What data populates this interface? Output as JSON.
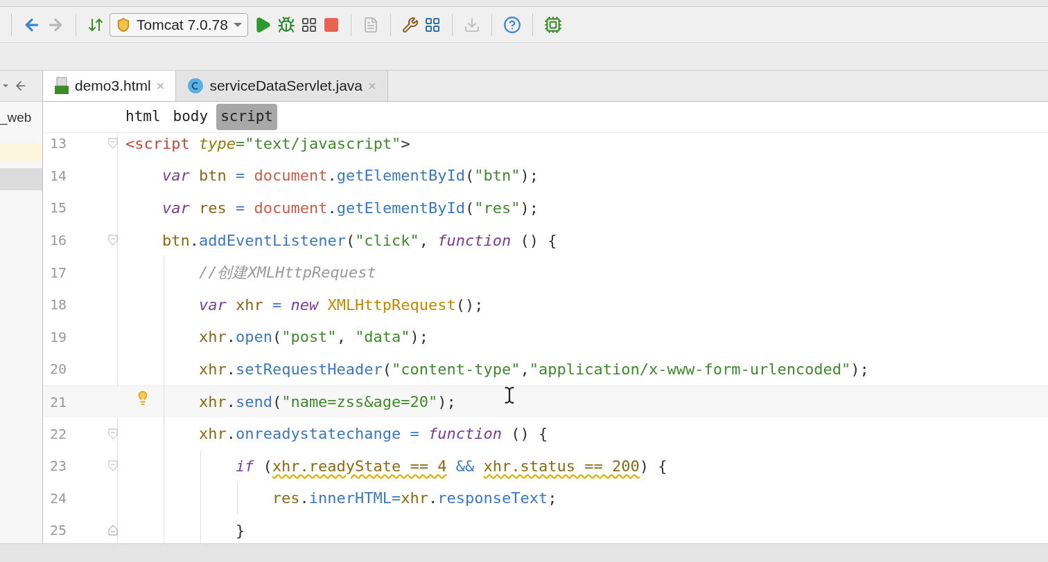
{
  "toolbar": {
    "run_config": "Tomcat 7.0.78"
  },
  "project_panel": {
    "label": "_web"
  },
  "tabs": [
    {
      "label": "demo3.html",
      "kind": "html",
      "selected": true,
      "close": "×"
    },
    {
      "label": "serviceDataServlet.java",
      "kind": "java",
      "selected": false,
      "close": "×"
    }
  ],
  "breadcrumbs": [
    {
      "label": "html",
      "selected": false
    },
    {
      "label": "body",
      "selected": false
    },
    {
      "label": "script",
      "selected": true
    }
  ],
  "code_lines": [
    {
      "number": "13",
      "tokens": [
        {
          "text": "<script",
          "kind": "tag"
        },
        {
          "text": " type",
          "kind": "attr"
        },
        {
          "text": "=\"text/javascript\"",
          "kind": "string"
        },
        {
          "text": ">",
          "kind": "plain"
        }
      ],
      "children": [
        {
          "number": "14",
          "tokens": [
            {
              "text": "var",
              "kind": "keyword"
            },
            {
              "text": " btn",
              "kind": "ident"
            },
            {
              "text": " = ",
              "kind": "op"
            },
            {
              "text": "document",
              "kind": "global"
            },
            {
              "text": ".",
              "kind": "plain"
            },
            {
              "text": "getElementById",
              "kind": "method"
            },
            {
              "text": "(",
              "kind": "plain"
            },
            {
              "text": "\"btn\"",
              "kind": "string"
            },
            {
              "text": ");",
              "kind": "plain"
            }
          ]
        },
        {
          "number": "15",
          "tokens": [
            {
              "text": "var",
              "kind": "keyword"
            },
            {
              "text": " res",
              "kind": "ident"
            },
            {
              "text": " = ",
              "kind": "op"
            },
            {
              "text": "document",
              "kind": "global"
            },
            {
              "text": ".",
              "kind": "plain"
            },
            {
              "text": "getElementById",
              "kind": "method"
            },
            {
              "text": "(",
              "kind": "plain"
            },
            {
              "text": "\"res\"",
              "kind": "string"
            },
            {
              "text": ");",
              "kind": "plain"
            }
          ]
        },
        {
          "number": "16",
          "tokens": [
            {
              "text": "btn",
              "kind": "ident"
            },
            {
              "text": ".",
              "kind": "plain"
            },
            {
              "text": "addEventListener",
              "kind": "method"
            },
            {
              "text": "(",
              "kind": "plain"
            },
            {
              "text": "\"click\"",
              "kind": "string"
            },
            {
              "text": ", ",
              "kind": "plain"
            },
            {
              "text": "function",
              "kind": "keyword"
            },
            {
              "text": " () {",
              "kind": "plain"
            }
          ],
          "children": [
            {
              "number": "17",
              "tokens": [
                {
                  "text": "//创建XMLHttpRequest",
                  "kind": "comment"
                }
              ]
            },
            {
              "number": "18",
              "tokens": [
                {
                  "text": "var",
                  "kind": "keyword"
                },
                {
                  "text": " xhr",
                  "kind": "ident"
                },
                {
                  "text": " = ",
                  "kind": "op"
                },
                {
                  "text": "new",
                  "kind": "keyword"
                },
                {
                  "text": " XMLHttpRequest",
                  "kind": "class"
                },
                {
                  "text": "();",
                  "kind": "plain"
                }
              ]
            },
            {
              "number": "19",
              "tokens": [
                {
                  "text": "xhr",
                  "kind": "ident"
                },
                {
                  "text": ".",
                  "kind": "plain"
                },
                {
                  "text": "open",
                  "kind": "method"
                },
                {
                  "text": "(",
                  "kind": "plain"
                },
                {
                  "text": "\"post\"",
                  "kind": "string"
                },
                {
                  "text": ", ",
                  "kind": "plain"
                },
                {
                  "text": "\"data\"",
                  "kind": "string"
                },
                {
                  "text": ");",
                  "kind": "plain"
                }
              ]
            },
            {
              "number": "20",
              "tokens": [
                {
                  "text": "xhr",
                  "kind": "ident"
                },
                {
                  "text": ".",
                  "kind": "plain"
                },
                {
                  "text": "setRequestHeader",
                  "kind": "method"
                },
                {
                  "text": "(",
                  "kind": "plain"
                },
                {
                  "text": "\"content-type\"",
                  "kind": "string"
                },
                {
                  "text": ",",
                  "kind": "plain"
                },
                {
                  "text": "\"application/x-www-form-urlencoded\"",
                  "kind": "string"
                },
                {
                  "text": ");",
                  "kind": "plain"
                }
              ]
            },
            {
              "number": "21",
              "current": true,
              "bulb": true,
              "tokens": [
                {
                  "text": "xhr",
                  "kind": "ident"
                },
                {
                  "text": ".",
                  "kind": "plain"
                },
                {
                  "text": "send",
                  "kind": "method"
                },
                {
                  "text": "(",
                  "kind": "plain"
                },
                {
                  "text": "\"name=zss&age=20\"",
                  "kind": "string"
                },
                {
                  "text": ");",
                  "kind": "plain"
                }
              ]
            },
            {
              "number": "22",
              "tokens": [
                {
                  "text": "xhr",
                  "kind": "ident"
                },
                {
                  "text": ".",
                  "kind": "plain"
                },
                {
                  "text": "onreadystatechange",
                  "kind": "method"
                },
                {
                  "text": " = ",
                  "kind": "op"
                },
                {
                  "text": "function",
                  "kind": "keyword"
                },
                {
                  "text": " () {",
                  "kind": "plain"
                }
              ],
              "children": [
                {
                  "number": "23",
                  "tokens": [
                    {
                      "text": "if",
                      "kind": "keyword"
                    },
                    {
                      "text": " (",
                      "kind": "plain"
                    },
                    {
                      "text": "xhr.readyState == 4",
                      "kind": "warn"
                    },
                    {
                      "text": " && ",
                      "kind": "op"
                    },
                    {
                      "text": "xhr.status == 200",
                      "kind": "warn"
                    },
                    {
                      "text": ") {",
                      "kind": "plain"
                    }
                  ],
                  "children": [
                    {
                      "number": "24",
                      "tokens": [
                        {
                          "text": "res",
                          "kind": "ident"
                        },
                        {
                          "text": ".",
                          "kind": "plain"
                        },
                        {
                          "text": "innerHTML",
                          "kind": "method"
                        },
                        {
                          "text": "=",
                          "kind": "op"
                        },
                        {
                          "text": "xhr",
                          "kind": "ident"
                        },
                        {
                          "text": ".",
                          "kind": "plain"
                        },
                        {
                          "text": "responseText",
                          "kind": "method"
                        },
                        {
                          "text": ";",
                          "kind": "plain"
                        }
                      ]
                    }
                  ]
                },
                {
                  "number": "25",
                  "fold_end": true,
                  "tokens": [
                    {
                      "text": "}",
                      "kind": "plain"
                    }
                  ]
                }
              ]
            }
          ]
        }
      ]
    }
  ]
}
